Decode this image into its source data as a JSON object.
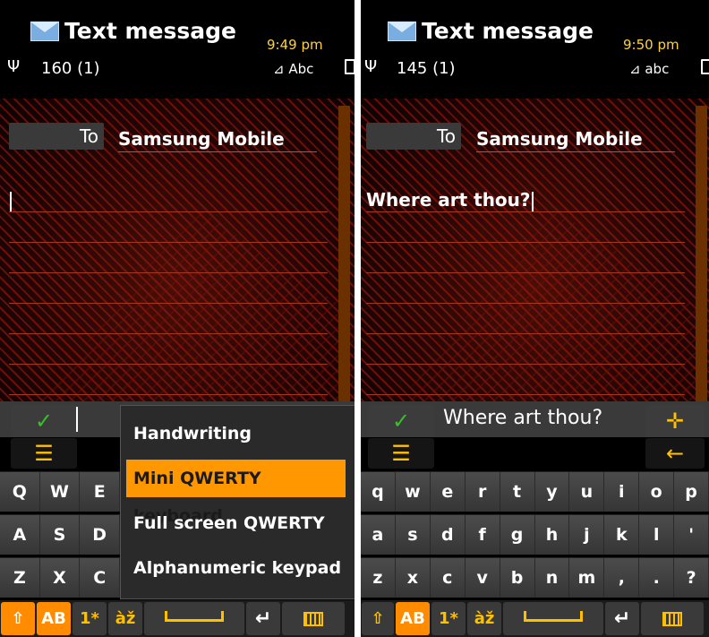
{
  "left": {
    "title": "Text message",
    "time": "9:49 pm",
    "signal_icon": "antenna-icon",
    "char_count": "160 (1)",
    "input_mode": "Abc",
    "to_label": "To",
    "recipient": "Samsung Mobile",
    "message": "",
    "keys_row1": [
      "Q",
      "W",
      "E"
    ],
    "keys_row2": [
      "A",
      "S",
      "D"
    ],
    "keys_row3": [
      "Z",
      "X",
      "C"
    ],
    "bottom": {
      "shift": "⇧",
      "abc": "AB",
      "num": "1*",
      "accent": "àž"
    },
    "menu": {
      "items": [
        "Handwriting",
        "Mini QWERTY keyboard",
        "Full screen QWERTY",
        "Alphanumeric keypad"
      ],
      "selected": "Mini QWERTY keyboard"
    }
  },
  "right": {
    "title": "Text message",
    "time": "9:50 pm",
    "signal_icon": "antenna-icon",
    "char_count": "145 (1)",
    "input_mode": "abc",
    "to_label": "To",
    "recipient": "Samsung Mobile",
    "message": "Where art thou?",
    "preview": "Where art thou?",
    "keys_row1": [
      "q",
      "w",
      "e",
      "r",
      "t",
      "y",
      "u",
      "i",
      "o",
      "p"
    ],
    "keys_row2": [
      "a",
      "s",
      "d",
      "f",
      "g",
      "h",
      "j",
      "k",
      "l",
      "'"
    ],
    "keys_row3": [
      "z",
      "x",
      "c",
      "v",
      "b",
      "n",
      "m",
      ",",
      ".",
      "?"
    ],
    "bottom": {
      "shift": "⇧",
      "abc": "AB",
      "num": "1*",
      "accent": "àž"
    }
  },
  "colors": {
    "accent": "#ff9800",
    "yellow": "#ffc000",
    "check": "#39c02a",
    "recipient_underline": "#d04a2a"
  }
}
